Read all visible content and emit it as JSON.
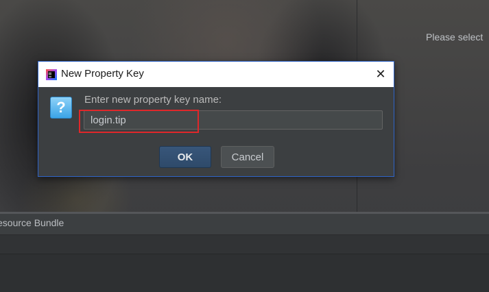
{
  "background": {
    "right_panel_text": "Please select",
    "bundle_tab": "esource Bundle"
  },
  "dialog": {
    "title": "New Property Key",
    "app_icon": "intellij-idea-icon",
    "close_label": "✕",
    "question_icon": "question-icon",
    "question_glyph": "?",
    "prompt": "Enter new property key name:",
    "input_value": "login.tip",
    "ok_label": "OK",
    "cancel_label": "Cancel"
  },
  "colors": {
    "dialog_border": "#2f65ca",
    "highlight": "#e0272a",
    "ok_button": "#365475"
  }
}
